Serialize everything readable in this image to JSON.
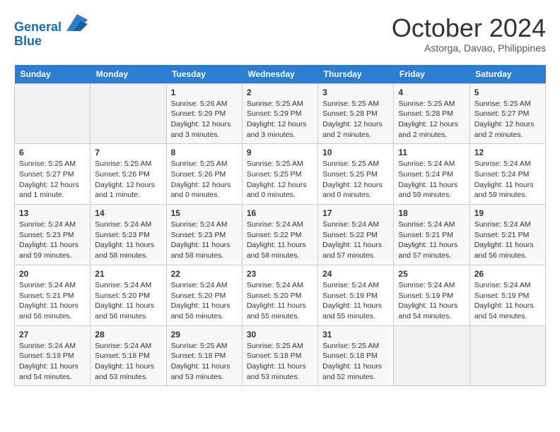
{
  "header": {
    "logo_line1": "General",
    "logo_line2": "Blue",
    "month_title": "October 2024",
    "location": "Astorga, Davao, Philippines"
  },
  "weekdays": [
    "Sunday",
    "Monday",
    "Tuesday",
    "Wednesday",
    "Thursday",
    "Friday",
    "Saturday"
  ],
  "weeks": [
    [
      {
        "day": "",
        "info": ""
      },
      {
        "day": "",
        "info": ""
      },
      {
        "day": "1",
        "info": "Sunrise: 5:26 AM\nSunset: 5:29 PM\nDaylight: 12 hours and 3 minutes."
      },
      {
        "day": "2",
        "info": "Sunrise: 5:25 AM\nSunset: 5:29 PM\nDaylight: 12 hours and 3 minutes."
      },
      {
        "day": "3",
        "info": "Sunrise: 5:25 AM\nSunset: 5:28 PM\nDaylight: 12 hours and 2 minutes."
      },
      {
        "day": "4",
        "info": "Sunrise: 5:25 AM\nSunset: 5:28 PM\nDaylight: 12 hours and 2 minutes."
      },
      {
        "day": "5",
        "info": "Sunrise: 5:25 AM\nSunset: 5:27 PM\nDaylight: 12 hours and 2 minutes."
      }
    ],
    [
      {
        "day": "6",
        "info": "Sunrise: 5:25 AM\nSunset: 5:27 PM\nDaylight: 12 hours and 1 minute."
      },
      {
        "day": "7",
        "info": "Sunrise: 5:25 AM\nSunset: 5:26 PM\nDaylight: 12 hours and 1 minute."
      },
      {
        "day": "8",
        "info": "Sunrise: 5:25 AM\nSunset: 5:26 PM\nDaylight: 12 hours and 0 minutes."
      },
      {
        "day": "9",
        "info": "Sunrise: 5:25 AM\nSunset: 5:25 PM\nDaylight: 12 hours and 0 minutes."
      },
      {
        "day": "10",
        "info": "Sunrise: 5:25 AM\nSunset: 5:25 PM\nDaylight: 12 hours and 0 minutes."
      },
      {
        "day": "11",
        "info": "Sunrise: 5:24 AM\nSunset: 5:24 PM\nDaylight: 11 hours and 59 minutes."
      },
      {
        "day": "12",
        "info": "Sunrise: 5:24 AM\nSunset: 5:24 PM\nDaylight: 11 hours and 59 minutes."
      }
    ],
    [
      {
        "day": "13",
        "info": "Sunrise: 5:24 AM\nSunset: 5:23 PM\nDaylight: 11 hours and 59 minutes."
      },
      {
        "day": "14",
        "info": "Sunrise: 5:24 AM\nSunset: 5:23 PM\nDaylight: 11 hours and 58 minutes."
      },
      {
        "day": "15",
        "info": "Sunrise: 5:24 AM\nSunset: 5:23 PM\nDaylight: 11 hours and 58 minutes."
      },
      {
        "day": "16",
        "info": "Sunrise: 5:24 AM\nSunset: 5:22 PM\nDaylight: 11 hours and 58 minutes."
      },
      {
        "day": "17",
        "info": "Sunrise: 5:24 AM\nSunset: 5:22 PM\nDaylight: 11 hours and 57 minutes."
      },
      {
        "day": "18",
        "info": "Sunrise: 5:24 AM\nSunset: 5:21 PM\nDaylight: 11 hours and 57 minutes."
      },
      {
        "day": "19",
        "info": "Sunrise: 5:24 AM\nSunset: 5:21 PM\nDaylight: 11 hours and 56 minutes."
      }
    ],
    [
      {
        "day": "20",
        "info": "Sunrise: 5:24 AM\nSunset: 5:21 PM\nDaylight: 11 hours and 56 minutes."
      },
      {
        "day": "21",
        "info": "Sunrise: 5:24 AM\nSunset: 5:20 PM\nDaylight: 11 hours and 56 minutes."
      },
      {
        "day": "22",
        "info": "Sunrise: 5:24 AM\nSunset: 5:20 PM\nDaylight: 11 hours and 56 minutes."
      },
      {
        "day": "23",
        "info": "Sunrise: 5:24 AM\nSunset: 5:20 PM\nDaylight: 11 hours and 55 minutes."
      },
      {
        "day": "24",
        "info": "Sunrise: 5:24 AM\nSunset: 5:19 PM\nDaylight: 11 hours and 55 minutes."
      },
      {
        "day": "25",
        "info": "Sunrise: 5:24 AM\nSunset: 5:19 PM\nDaylight: 11 hours and 54 minutes."
      },
      {
        "day": "26",
        "info": "Sunrise: 5:24 AM\nSunset: 5:19 PM\nDaylight: 11 hours and 54 minutes."
      }
    ],
    [
      {
        "day": "27",
        "info": "Sunrise: 5:24 AM\nSunset: 5:19 PM\nDaylight: 11 hours and 54 minutes."
      },
      {
        "day": "28",
        "info": "Sunrise: 5:24 AM\nSunset: 5:18 PM\nDaylight: 11 hours and 53 minutes."
      },
      {
        "day": "29",
        "info": "Sunrise: 5:25 AM\nSunset: 5:18 PM\nDaylight: 11 hours and 53 minutes."
      },
      {
        "day": "30",
        "info": "Sunrise: 5:25 AM\nSunset: 5:18 PM\nDaylight: 11 hours and 53 minutes."
      },
      {
        "day": "31",
        "info": "Sunrise: 5:25 AM\nSunset: 5:18 PM\nDaylight: 11 hours and 52 minutes."
      },
      {
        "day": "",
        "info": ""
      },
      {
        "day": "",
        "info": ""
      }
    ]
  ]
}
